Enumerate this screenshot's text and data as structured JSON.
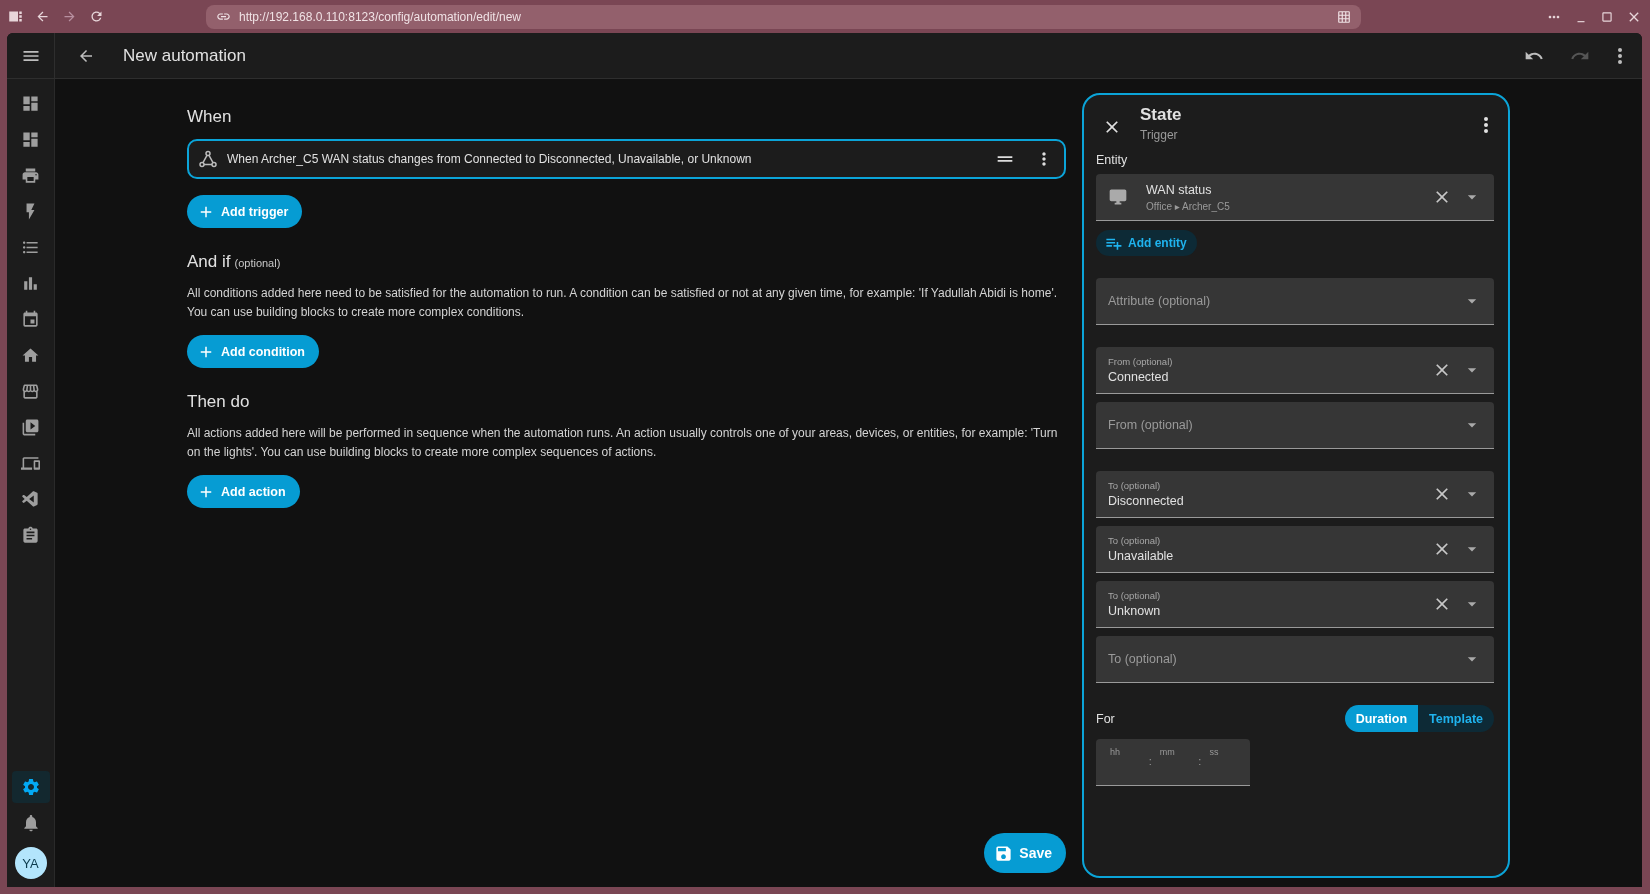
{
  "browser": {
    "url": "http://192.168.0.110:8123/config/automation/edit/new"
  },
  "header": {
    "title": "New automation",
    "undo": {
      "disabled": false
    },
    "redo": {
      "disabled": true
    }
  },
  "sidebar": {
    "items": [
      {
        "selected": false
      },
      {
        "selected": false
      },
      {
        "selected": false
      },
      {
        "selected": false
      },
      {
        "selected": false
      },
      {
        "selected": false
      },
      {
        "selected": false
      },
      {
        "selected": false
      },
      {
        "selected": false
      },
      {
        "selected": false
      },
      {
        "selected": false
      },
      {
        "selected": false
      },
      {
        "selected": false
      }
    ],
    "bottom_items": [
      {
        "selected": true
      },
      {
        "selected": false
      }
    ],
    "avatar": "YA"
  },
  "editor": {
    "sections": [
      {
        "title": "When",
        "triggers": [
          "When Archer_C5 WAN status changes from Connected to Disconnected, Unavailable, or Unknown"
        ],
        "button": "Add trigger"
      },
      {
        "title": "And if",
        "note": "(optional)",
        "description": "All conditions added here need to be satisfied for the automation to run. A condition can be satisfied or not at any given time, for example: 'If Yadullah Abidi is home'. You can use building blocks to create more complex conditions.",
        "button": "Add condition"
      },
      {
        "title": "Then do",
        "description": "All actions added here will be performed in sequence when the automation runs. An action usually controls one of your areas, devices, or entities, for example: 'Turn on the lights'. You can use building blocks to create more complex sequences of actions.",
        "button": "Add action"
      }
    ],
    "save_button": "Save"
  },
  "panel": {
    "title": "State",
    "subtitle": "Trigger",
    "entity_label": "Entity",
    "entity": {
      "name": "WAN status",
      "path": "Office ▸ Archer_C5"
    },
    "add_entity": "Add entity",
    "field_groups": [
      [
        {
          "kind": "select",
          "label": "Attribute (optional)"
        }
      ],
      [
        {
          "kind": "select",
          "label": "From (optional)",
          "value": "Connected"
        },
        {
          "kind": "select",
          "label": "From (optional)"
        }
      ],
      [
        {
          "kind": "select",
          "label": "To (optional)",
          "value": "Disconnected"
        },
        {
          "kind": "select",
          "label": "To (optional)",
          "value": "Unavailable"
        },
        {
          "kind": "select",
          "label": "To (optional)",
          "value": "Unknown"
        },
        {
          "kind": "select",
          "label": "To (optional)"
        }
      ]
    ],
    "for_label": "For",
    "modes": [
      {
        "label": "Duration",
        "selected": true
      },
      {
        "label": "Template",
        "selected": false
      }
    ],
    "duration": {
      "placeholders": [
        "hh",
        "mm",
        "ss"
      ],
      "separator": ":"
    }
  }
}
